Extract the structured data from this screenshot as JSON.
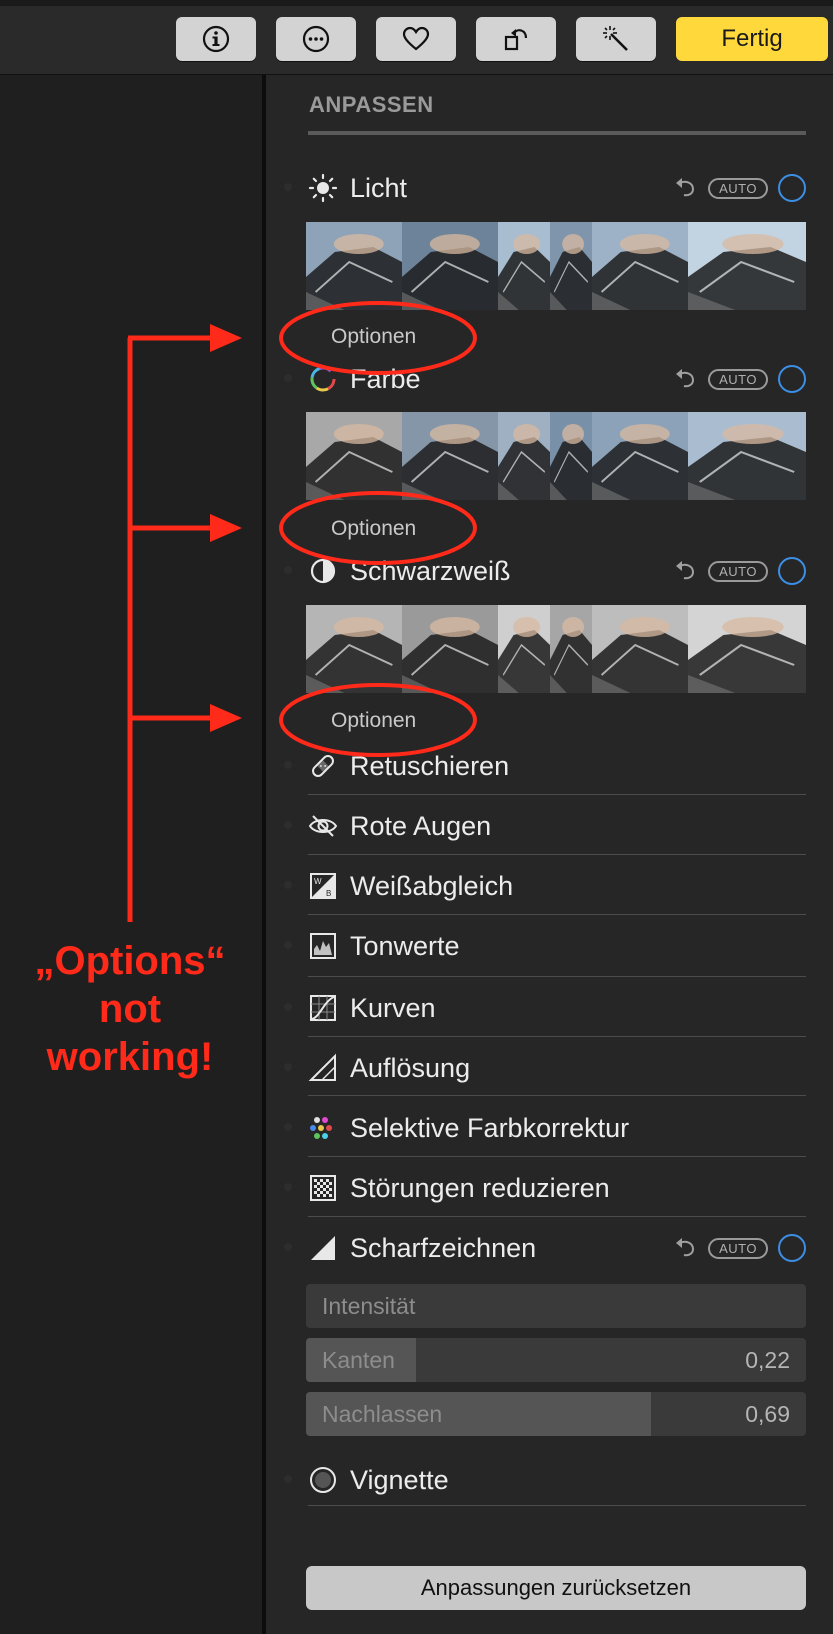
{
  "toolbar": {
    "buttons": [
      "info-icon",
      "more-icon",
      "heart-icon",
      "rotate-icon",
      "magic-wand-icon"
    ],
    "done_label": "Fertig"
  },
  "panel": {
    "title": "ANPASSEN",
    "auto_label": "AUTO",
    "options_label": "Optionen",
    "sections": {
      "licht": "Licht",
      "farbe": "Farbe",
      "schwarzweiss": "Schwarzweiß",
      "retuschieren": "Retuschieren",
      "rote_augen": "Rote Augen",
      "weissabgleich": "Weißabgleich",
      "tonwerte": "Tonwerte",
      "kurven": "Kurven",
      "aufloesung": "Auflösung",
      "selektive": "Selektive Farbkorrektur",
      "stoerungen": "Störungen reduzieren",
      "scharfzeichnen": "Scharfzeichnen",
      "vignette": "Vignette"
    },
    "sharpen": {
      "intensity_label": "Intensität",
      "edges_label": "Kanten",
      "edges_value": "0,22",
      "edges_fraction": 0.22,
      "falloff_label": "Nachlassen",
      "falloff_value": "0,69",
      "falloff_fraction": 0.69
    },
    "reset_label": "Anpassungen zurücksetzen"
  },
  "annotation": {
    "text_line1": "„Options“",
    "text_line2": "not",
    "text_line3": "working!",
    "color": "#ff2a1a"
  },
  "colors": {
    "accent_yellow": "#ffd93b",
    "ring_blue": "#3d8fe6"
  }
}
